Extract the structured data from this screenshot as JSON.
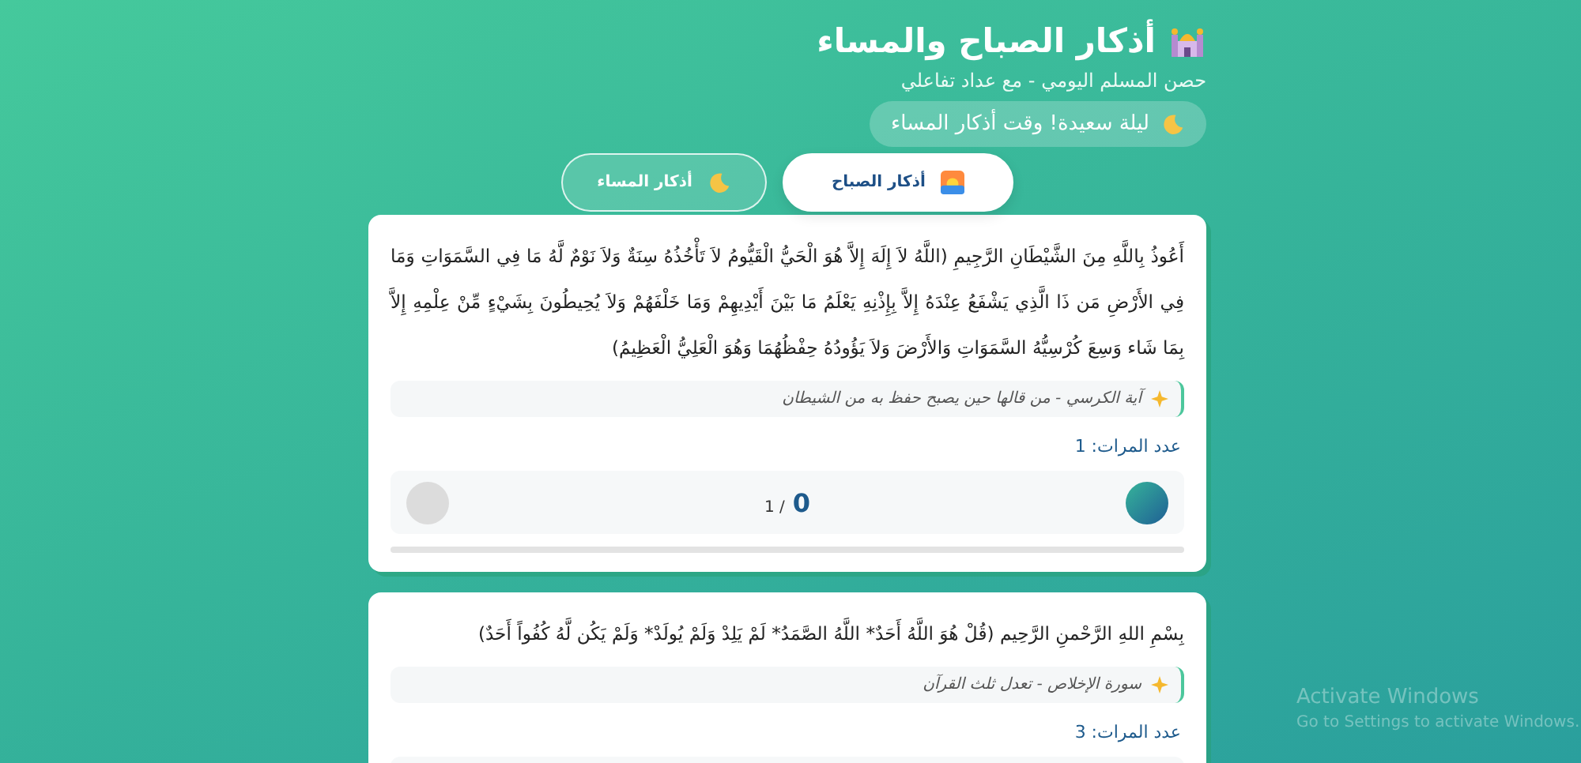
{
  "header": {
    "title": "أذكار الصباح والمساء",
    "subtitle": "حصن المسلم اليومي - مع عداد تفاعلي",
    "greeting": "ليلة سعيدة! وقت أذكار المساء"
  },
  "tabs": [
    {
      "label": "أذكار الصباح",
      "kind": "morning",
      "selected": true
    },
    {
      "label": "أذكار المساء",
      "kind": "evening",
      "selected": false
    }
  ],
  "cards": [
    {
      "text": "أَعُوذُ بِاللَّهِ مِنَ الشَّيْطَانِ الرَّجِيمِ (اللَّهُ لاَ إِلَهَ إِلاَّ هُوَ الْحَيُّ الْقَيُّومُ لاَ تَأْخُذُهُ سِنَةٌ وَلاَ نَوْمٌ لَّهُ مَا فِي السَّمَوَاتِ وَمَا فِي الأَرْضِ مَن ذَا الَّذِي يَشْفَعُ عِنْدَهُ إِلاَّ بِإِذْنِهِ يَعْلَمُ مَا بَيْنَ أَيْدِيهِمْ وَمَا خَلْفَهُمْ وَلاَ يُحِيطُونَ بِشَيْءٍ مِّنْ عِلْمِهِ إِلاَّ بِمَا شَاء وَسِعَ كُرْسِيُّهُ السَّمَوَاتِ وَالأَرْضَ وَلاَ يَؤُودُهُ حِفْظُهُمَا وَهُوَ الْعَلِيُّ الْعَظِيمُ)",
      "note": "آية الكرسي - من قالها حين يصبح حفظ به من الشيطان",
      "repeat": "عدد المرات: 1",
      "counter": {
        "count": "0",
        "total": "/ 1"
      }
    },
    {
      "text": "بِسْمِ اللهِ الرَّحْمنِ الرَّحِيم (قُلْ هُوَ اللَّهُ أَحَدٌ* اللَّهُ الصَّمَدُ* لَمْ يَلِدْ وَلَمْ يُولَدْ* وَلَمْ يَكُن لَّهُ كُفُواً أَحَدٌ)",
      "note": "سورة الإخلاص - تعدل ثلث القرآن",
      "repeat": "عدد المرات: 3"
    }
  ],
  "os_notice": {
    "title": "Activate Windows",
    "text": "Go to Settings to activate Windows."
  }
}
